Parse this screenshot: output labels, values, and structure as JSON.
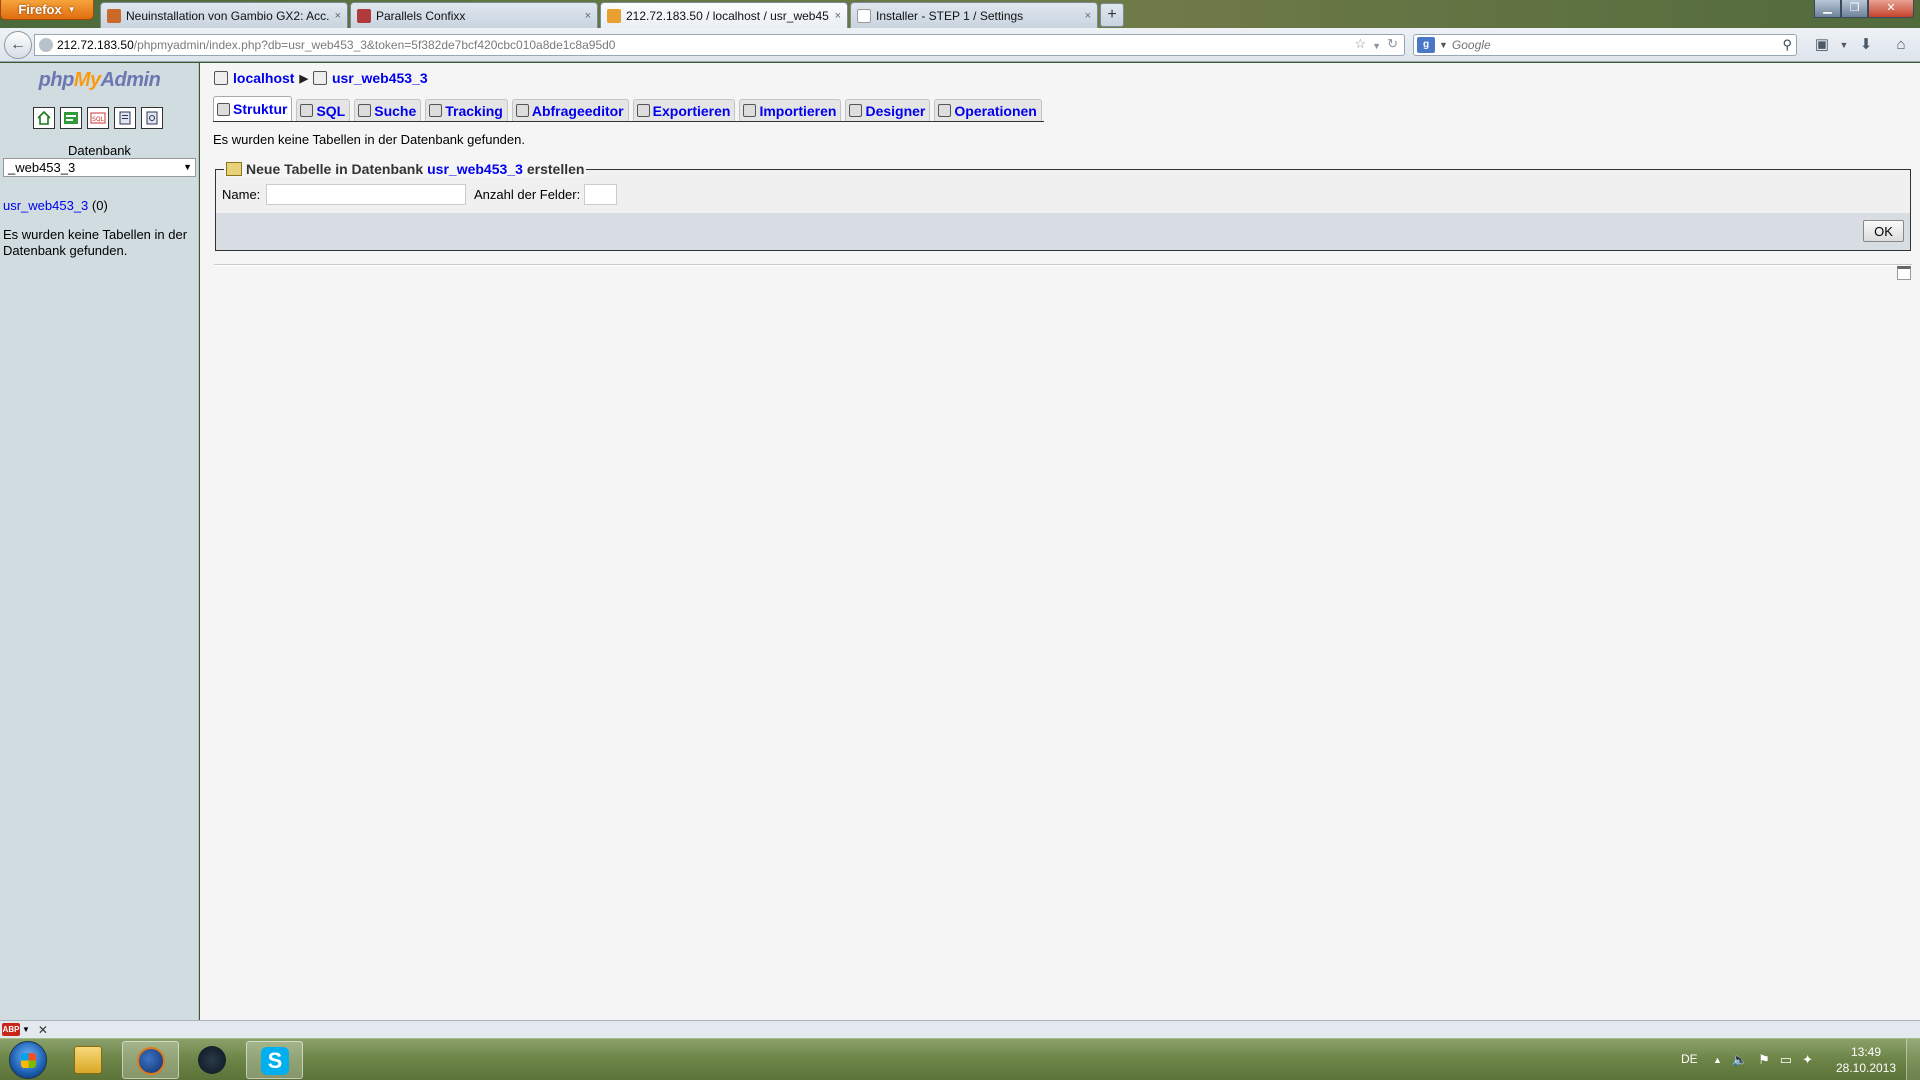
{
  "browser": {
    "menu_button": "Firefox",
    "tabs": [
      {
        "title": "Neuinstallation von Gambio GX2: Acc...",
        "close": "×"
      },
      {
        "title": "Parallels Confixx",
        "close": "×"
      },
      {
        "title": "212.72.183.50 / localhost / usr_web45...",
        "close": "×"
      },
      {
        "title": "Installer - STEP 1 / Settings",
        "close": "×"
      }
    ],
    "new_tab": "+",
    "url_host": "212.72.183.50",
    "url_path": "/phpmyadmin/index.php?db=usr_web453_3&token=5f382de7bcf420cbc010a8de1c8a95d0",
    "search_placeholder": "Google"
  },
  "sidebar": {
    "logo_php": "php",
    "logo_my": "My",
    "logo_admin": "Admin",
    "db_label": "Datenbank",
    "db_selected": "_web453_3",
    "db_link": "usr_web453_3",
    "db_count": " (0)",
    "no_tables": "Es wurden keine Tabellen in der Datenbank gefunden."
  },
  "breadcrumb": {
    "server": "localhost",
    "database": "usr_web453_3"
  },
  "tabs": [
    {
      "label": "Struktur"
    },
    {
      "label": "SQL"
    },
    {
      "label": "Suche"
    },
    {
      "label": "Tracking"
    },
    {
      "label": "Abfrageeditor"
    },
    {
      "label": "Exportieren"
    },
    {
      "label": "Importieren"
    },
    {
      "label": "Designer"
    },
    {
      "label": "Operationen"
    }
  ],
  "main": {
    "no_tables": "Es wurden keine Tabellen in der Datenbank gefunden.",
    "legend_prefix": "Neue Tabelle in Datenbank",
    "legend_db": "usr_web453_3",
    "legend_suffix": "erstellen",
    "name_label": "Name:",
    "fields_label": "Anzahl der Felder:",
    "ok": "OK"
  },
  "taskbar": {
    "lang": "DE",
    "time": "13:49",
    "date": "28.10.2013",
    "skype_letter": "S"
  }
}
